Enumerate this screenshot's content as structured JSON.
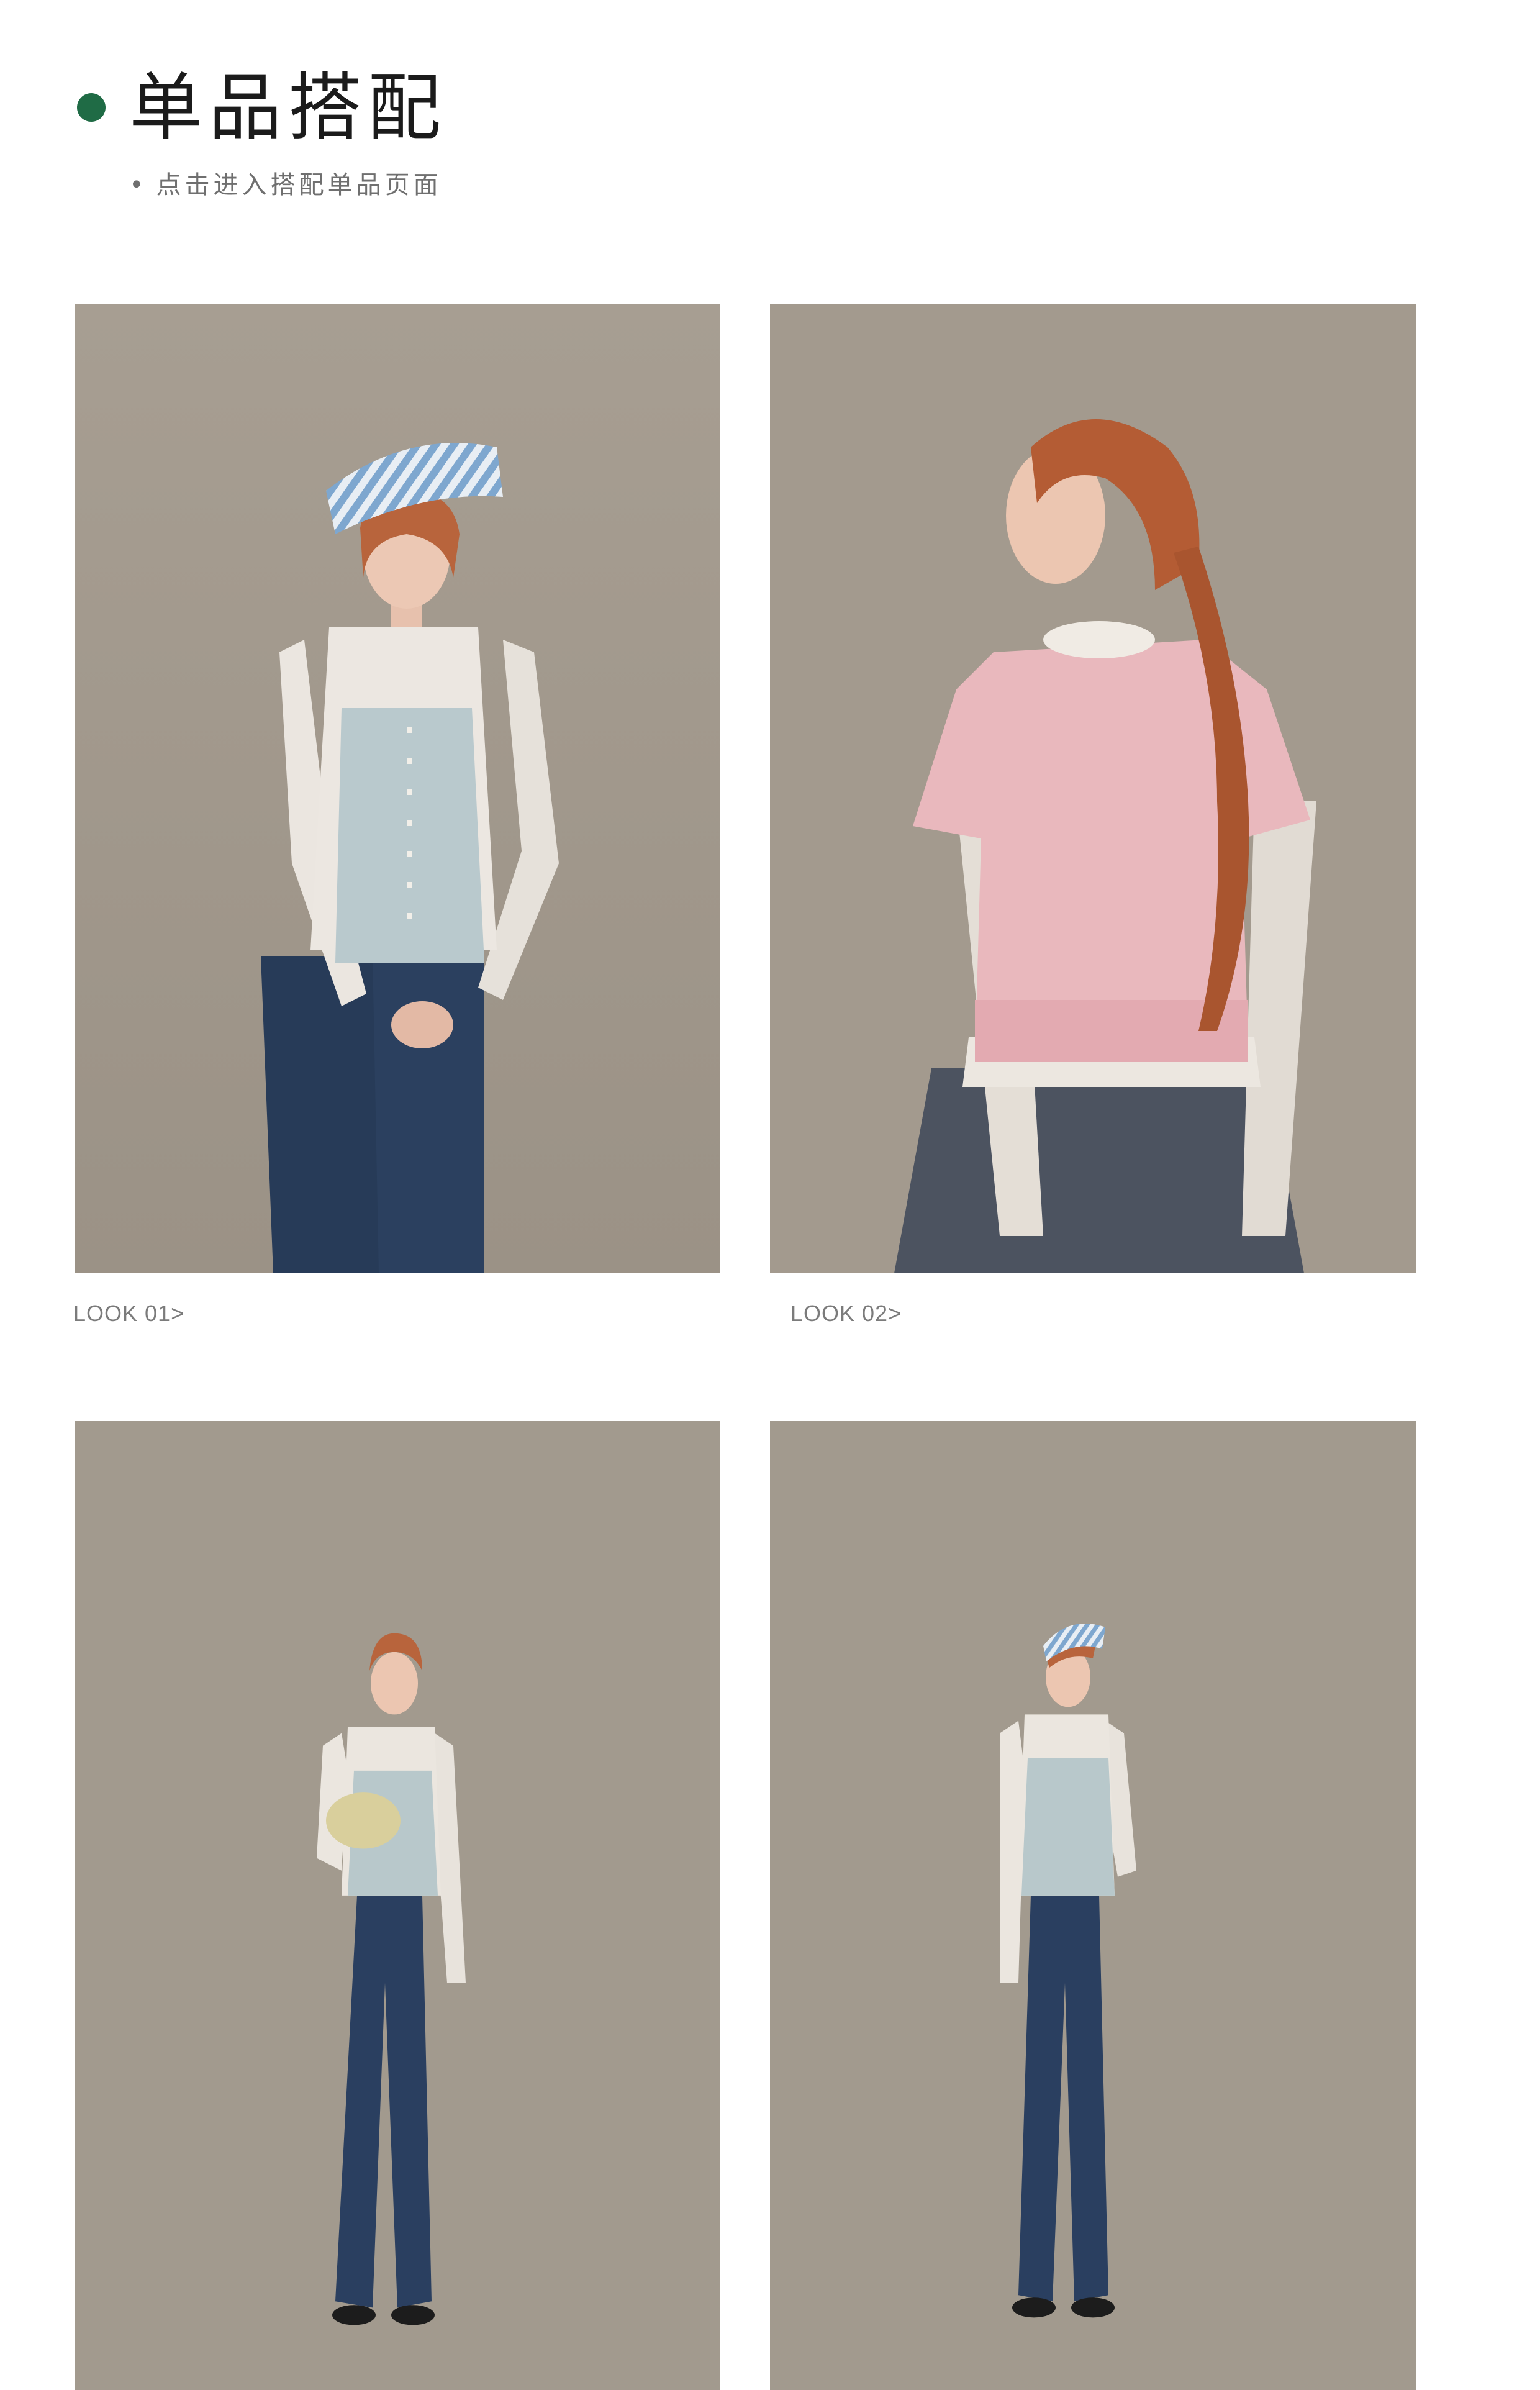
{
  "header": {
    "title": "单品搭配",
    "subtitle_bullet": "•",
    "subtitle": "点击进入搭配单品页面",
    "accent_color": "#1f6b45"
  },
  "looks": [
    {
      "label": "LOOK 01>",
      "image": "model-lace-top-blue-cami-bandana-image"
    },
    {
      "label": "LOOK 02>",
      "image": "model-pink-knit-braid-back-image"
    },
    {
      "label": "",
      "image": "model-full-outfit-bag-image"
    },
    {
      "label": "",
      "image": "model-full-outfit-bandana-image"
    }
  ]
}
